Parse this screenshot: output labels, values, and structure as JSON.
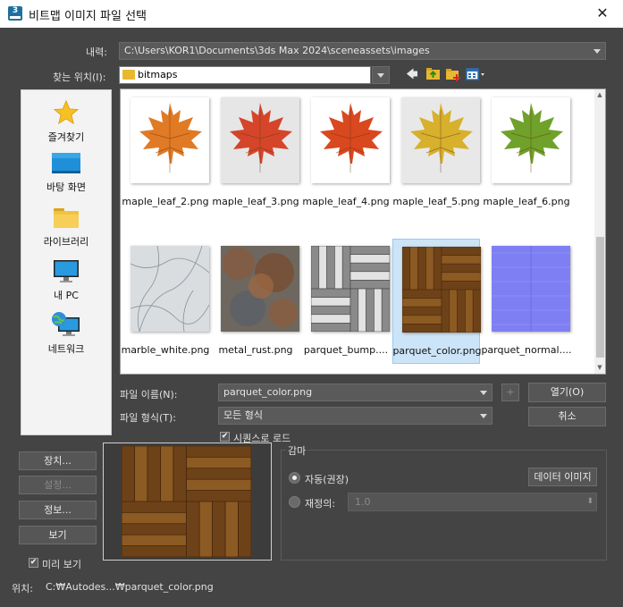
{
  "window": {
    "title": "비트맵 이미지 파일 선택",
    "close_glyph": "✕",
    "app_icon_text": "3"
  },
  "history": {
    "label": "내력:",
    "path": "C:\\Users\\KOR1\\Documents\\3ds Max 2024\\sceneassets\\images"
  },
  "look_in": {
    "label": "찾는 위치(I):",
    "folder": "bitmaps"
  },
  "toolbar": {
    "back_glyph": "🡄",
    "up_glyph": "↥",
    "newfolder_glyph": "✚",
    "view_glyph": "▦"
  },
  "places": [
    {
      "label": "즐겨찾기",
      "icon": "star-icon"
    },
    {
      "label": "바탕 화면",
      "icon": "desktop-icon"
    },
    {
      "label": "라이브러리",
      "icon": "folder-icon"
    },
    {
      "label": "내 PC",
      "icon": "monitor-icon"
    },
    {
      "label": "네트워크",
      "icon": "network-icon"
    }
  ],
  "files": [
    {
      "name": "maple_leaf_2.png",
      "kind": "leaf",
      "color": "#e07a25",
      "bg": "#ffffff"
    },
    {
      "name": "maple_leaf_3.png",
      "kind": "leaf",
      "color": "#d5452a",
      "bg": "#e6e6e6"
    },
    {
      "name": "maple_leaf_4.png",
      "kind": "leaf",
      "color": "#d9481f",
      "bg": "#ffffff"
    },
    {
      "name": "maple_leaf_5.png",
      "kind": "leaf",
      "color": "#d7b02c",
      "bg": "#e8e8e8"
    },
    {
      "name": "maple_leaf_6.png",
      "kind": "leaf",
      "color": "#6fa12b",
      "bg": "#ffffff"
    },
    {
      "name": "marble_white.png",
      "kind": "marble"
    },
    {
      "name": "metal_rust.png",
      "kind": "rust"
    },
    {
      "name": "parquet_bump....",
      "kind": "parquet-gray"
    },
    {
      "name": "parquet_color.png",
      "kind": "parquet",
      "selected": true
    },
    {
      "name": "parquet_normal....",
      "kind": "normal"
    }
  ],
  "filename": {
    "label": "파일 이름(N):",
    "value": "parquet_color.png"
  },
  "filetype": {
    "label": "파일 형식(T):",
    "value": "모든 형식"
  },
  "buttons": {
    "open": "열기(O)",
    "cancel": "취소",
    "plus": "+",
    "devices": "장치...",
    "setup": "설정...",
    "info": "정보...",
    "view": "보기"
  },
  "sequence": {
    "label": "시퀀스로 로드",
    "checked": true
  },
  "preview": {
    "label": "미리 보기",
    "checked": true
  },
  "gamma": {
    "title": "감마",
    "auto_label": "자동(권장)",
    "override_label": "재정의:",
    "data_image_button": "데이터 이미지",
    "override_value": "1.0"
  },
  "location": {
    "label": "위치:",
    "value": "C:₩Autodes...₩parquet_color.png"
  },
  "check_glyph": "✔",
  "spin_glyph": "⬍"
}
